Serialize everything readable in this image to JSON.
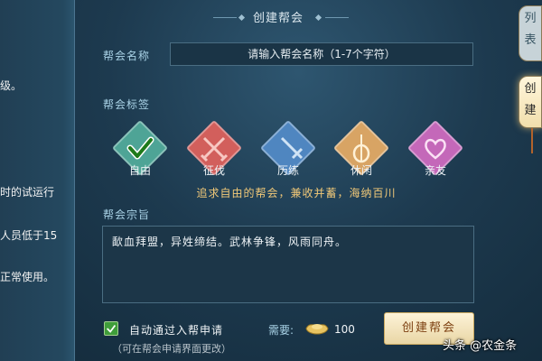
{
  "left_panel": {
    "lines": [
      "级。",
      "时的试运行",
      "人员低于15",
      "正常使用。"
    ]
  },
  "title": "创建帮会",
  "guild_name": {
    "label": "帮会名称",
    "placeholder": "请输入帮会名称（1-7个字符）"
  },
  "tags": {
    "label": "帮会标签",
    "items": [
      {
        "label": "自由",
        "color": "#4ea496",
        "icon": "check-icon"
      },
      {
        "label": "征伐",
        "color": "#d25f5c",
        "icon": "crossed-swords-icon"
      },
      {
        "label": "历练",
        "color": "#4f86c0",
        "icon": "sword-icon"
      },
      {
        "label": "休闲",
        "color": "#d8a464",
        "icon": "lute-icon"
      },
      {
        "label": "亲友",
        "color": "#c468b9",
        "icon": "heart-icon"
      }
    ],
    "description": "追求自由的帮会，兼收并蓄，海纳百川"
  },
  "purpose": {
    "label": "帮会宗旨",
    "text": "歃血拜盟，异姓缔结。武林争锋，风雨同舟。"
  },
  "auto_approve": {
    "label": "自动通过入帮申请",
    "hint": "（可在帮会申请界面更改）",
    "checked": true
  },
  "cost": {
    "label": "需要:",
    "value": "100",
    "icon": "gold-ingot-icon"
  },
  "create_button": {
    "label": "创建帮会"
  },
  "side_tabs": [
    {
      "chars": [
        "列",
        "表"
      ]
    },
    {
      "chars": [
        "创",
        "建"
      ]
    }
  ],
  "watermark": "头条 @农金条"
}
